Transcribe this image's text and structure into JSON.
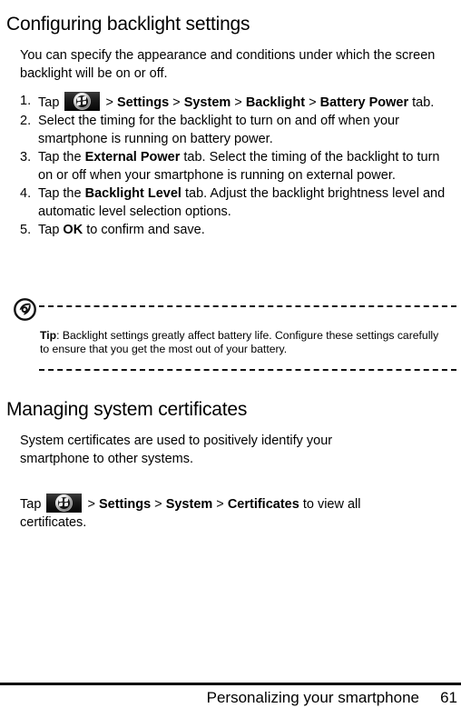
{
  "document": {
    "sections": [
      {
        "heading": "Configuring backlight settings",
        "intro": "You can specify the appearance and conditions under which the screen backlight will be on or off."
      },
      {
        "heading": "Managing system certificates",
        "intro": "System certificates are used to positively identify your smartphone to other systems."
      }
    ]
  },
  "backlight_steps": [
    {
      "number": "1.",
      "prefix": "Tap ",
      "icon": "windows-start-icon",
      "parts": [
        {
          "text": " > ",
          "bold": false
        },
        {
          "text": "Settings",
          "bold": true
        },
        {
          "text": " > ",
          "bold": false
        },
        {
          "text": "System",
          "bold": true
        },
        {
          "text": " > ",
          "bold": false
        },
        {
          "text": "Backlight",
          "bold": true
        },
        {
          "text": " > ",
          "bold": false
        },
        {
          "text": "Battery Power",
          "bold": true
        },
        {
          "text": " tab.",
          "bold": false
        }
      ]
    },
    {
      "number": "2.",
      "prefix": "",
      "icon": null,
      "parts": [
        {
          "text": "Select the timing for the backlight to turn on and off when your smartphone is running on battery power.",
          "bold": false
        }
      ]
    },
    {
      "number": "3.",
      "prefix": "",
      "icon": null,
      "parts": [
        {
          "text": "Tap the ",
          "bold": false
        },
        {
          "text": "External Power",
          "bold": true
        },
        {
          "text": " tab. Select the timing of the backlight to turn on or off when your smartphone is running on external power.",
          "bold": false
        }
      ]
    },
    {
      "number": "4.",
      "prefix": "",
      "icon": null,
      "parts": [
        {
          "text": "Tap the ",
          "bold": false
        },
        {
          "text": "Backlight Level",
          "bold": true
        },
        {
          "text": " tab. Adjust the backlight brightness level and automatic level selection options.",
          "bold": false
        }
      ]
    },
    {
      "number": "5.",
      "prefix": "",
      "icon": null,
      "parts": [
        {
          "text": "Tap ",
          "bold": false
        },
        {
          "text": "OK",
          "bold": true
        },
        {
          "text": " to confirm and save.",
          "bold": false
        }
      ]
    }
  ],
  "tip": {
    "icon": "acer-logo-icon",
    "label": "Tip",
    "separator": ": ",
    "text": "Backlight settings greatly affect battery life. Configure these settings carefully to ensure that you get the most out of your battery."
  },
  "certificates_tap_line": {
    "prefix": "Tap ",
    "icon": "windows-start-icon",
    "parts": [
      {
        "text": " > ",
        "bold": false
      },
      {
        "text": "Settings",
        "bold": true
      },
      {
        "text": " > ",
        "bold": false
      },
      {
        "text": "System",
        "bold": true
      },
      {
        "text": " > ",
        "bold": false
      },
      {
        "text": "Certificates",
        "bold": true
      },
      {
        "text": " to view all certificates.",
        "bold": false
      }
    ]
  },
  "footer": {
    "title": "Personalizing your smartphone",
    "page_number": "61"
  },
  "colors": {
    "text": "#000000",
    "background": "#ffffff",
    "rule": "#000000"
  }
}
